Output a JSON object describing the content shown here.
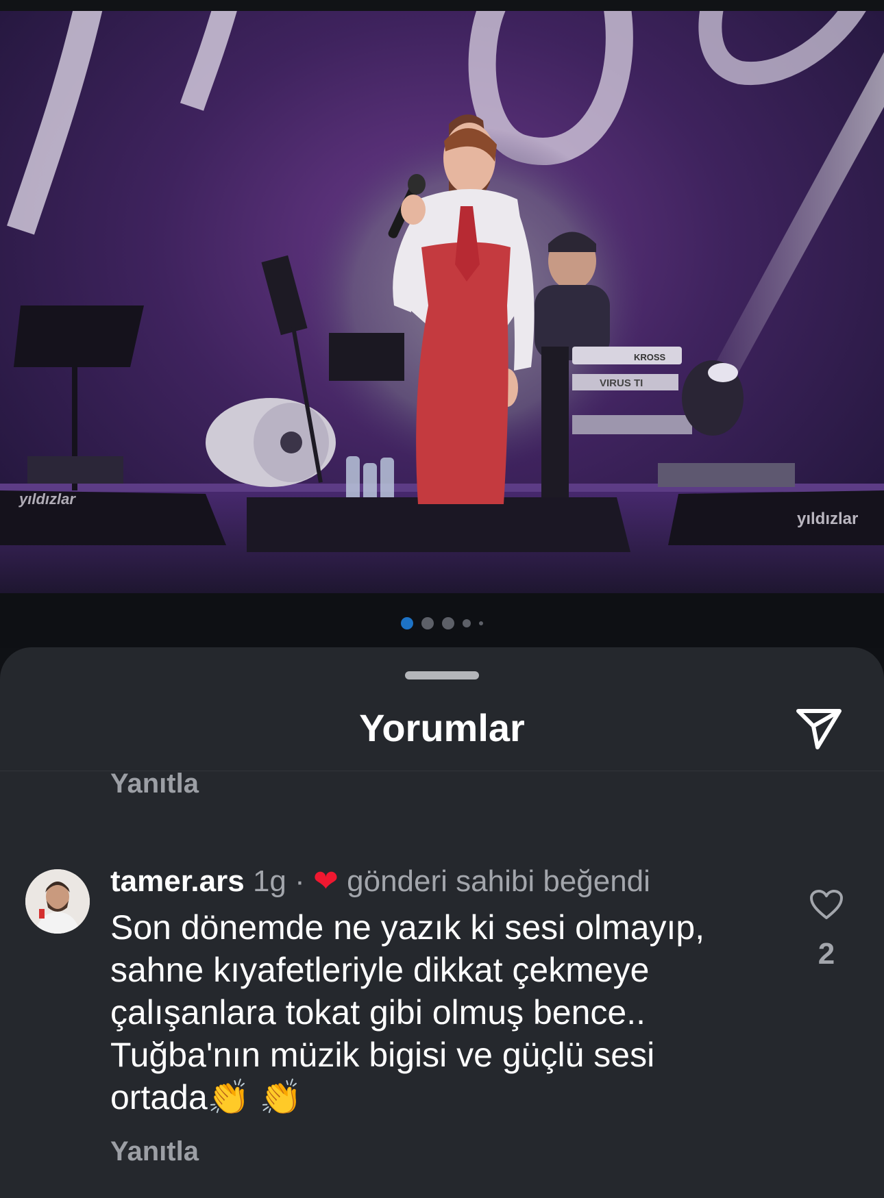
{
  "carousel": {
    "image_alt": "Female singer in white shirt and red dress with red tie singing into a microphone on a concert stage with a keyboard player behind her",
    "watermark_left": "yıldızlar",
    "watermark_right": "yıldızlar",
    "keyboard_brand_1": "KROSS",
    "keyboard_brand_2": "VIRUS TI",
    "page_count": 5,
    "active_index": 0
  },
  "sheet": {
    "title": "Yorumlar"
  },
  "previous_comment": {
    "reply_label": "Yanıtla"
  },
  "comment": {
    "username": "tamer.ars",
    "time": "1g",
    "separator": "·",
    "liked_by_author": "gönderi sahibi beğendi",
    "text": "Son dönemde ne yazık ki sesi olmayıp,\nsahne kıyafetleriyle dikkat çekmeye\nçalışanlara tokat gibi olmuş bence..\nTuğba'nın müzik bigisi ve güçlü sesi\nortada👏 👏",
    "reply_label": "Yanıtla",
    "like_count": "2"
  },
  "colors": {
    "accent_blue": "#1d73c6",
    "heart_red": "#ef1830",
    "sheet_bg": "#25282d"
  }
}
